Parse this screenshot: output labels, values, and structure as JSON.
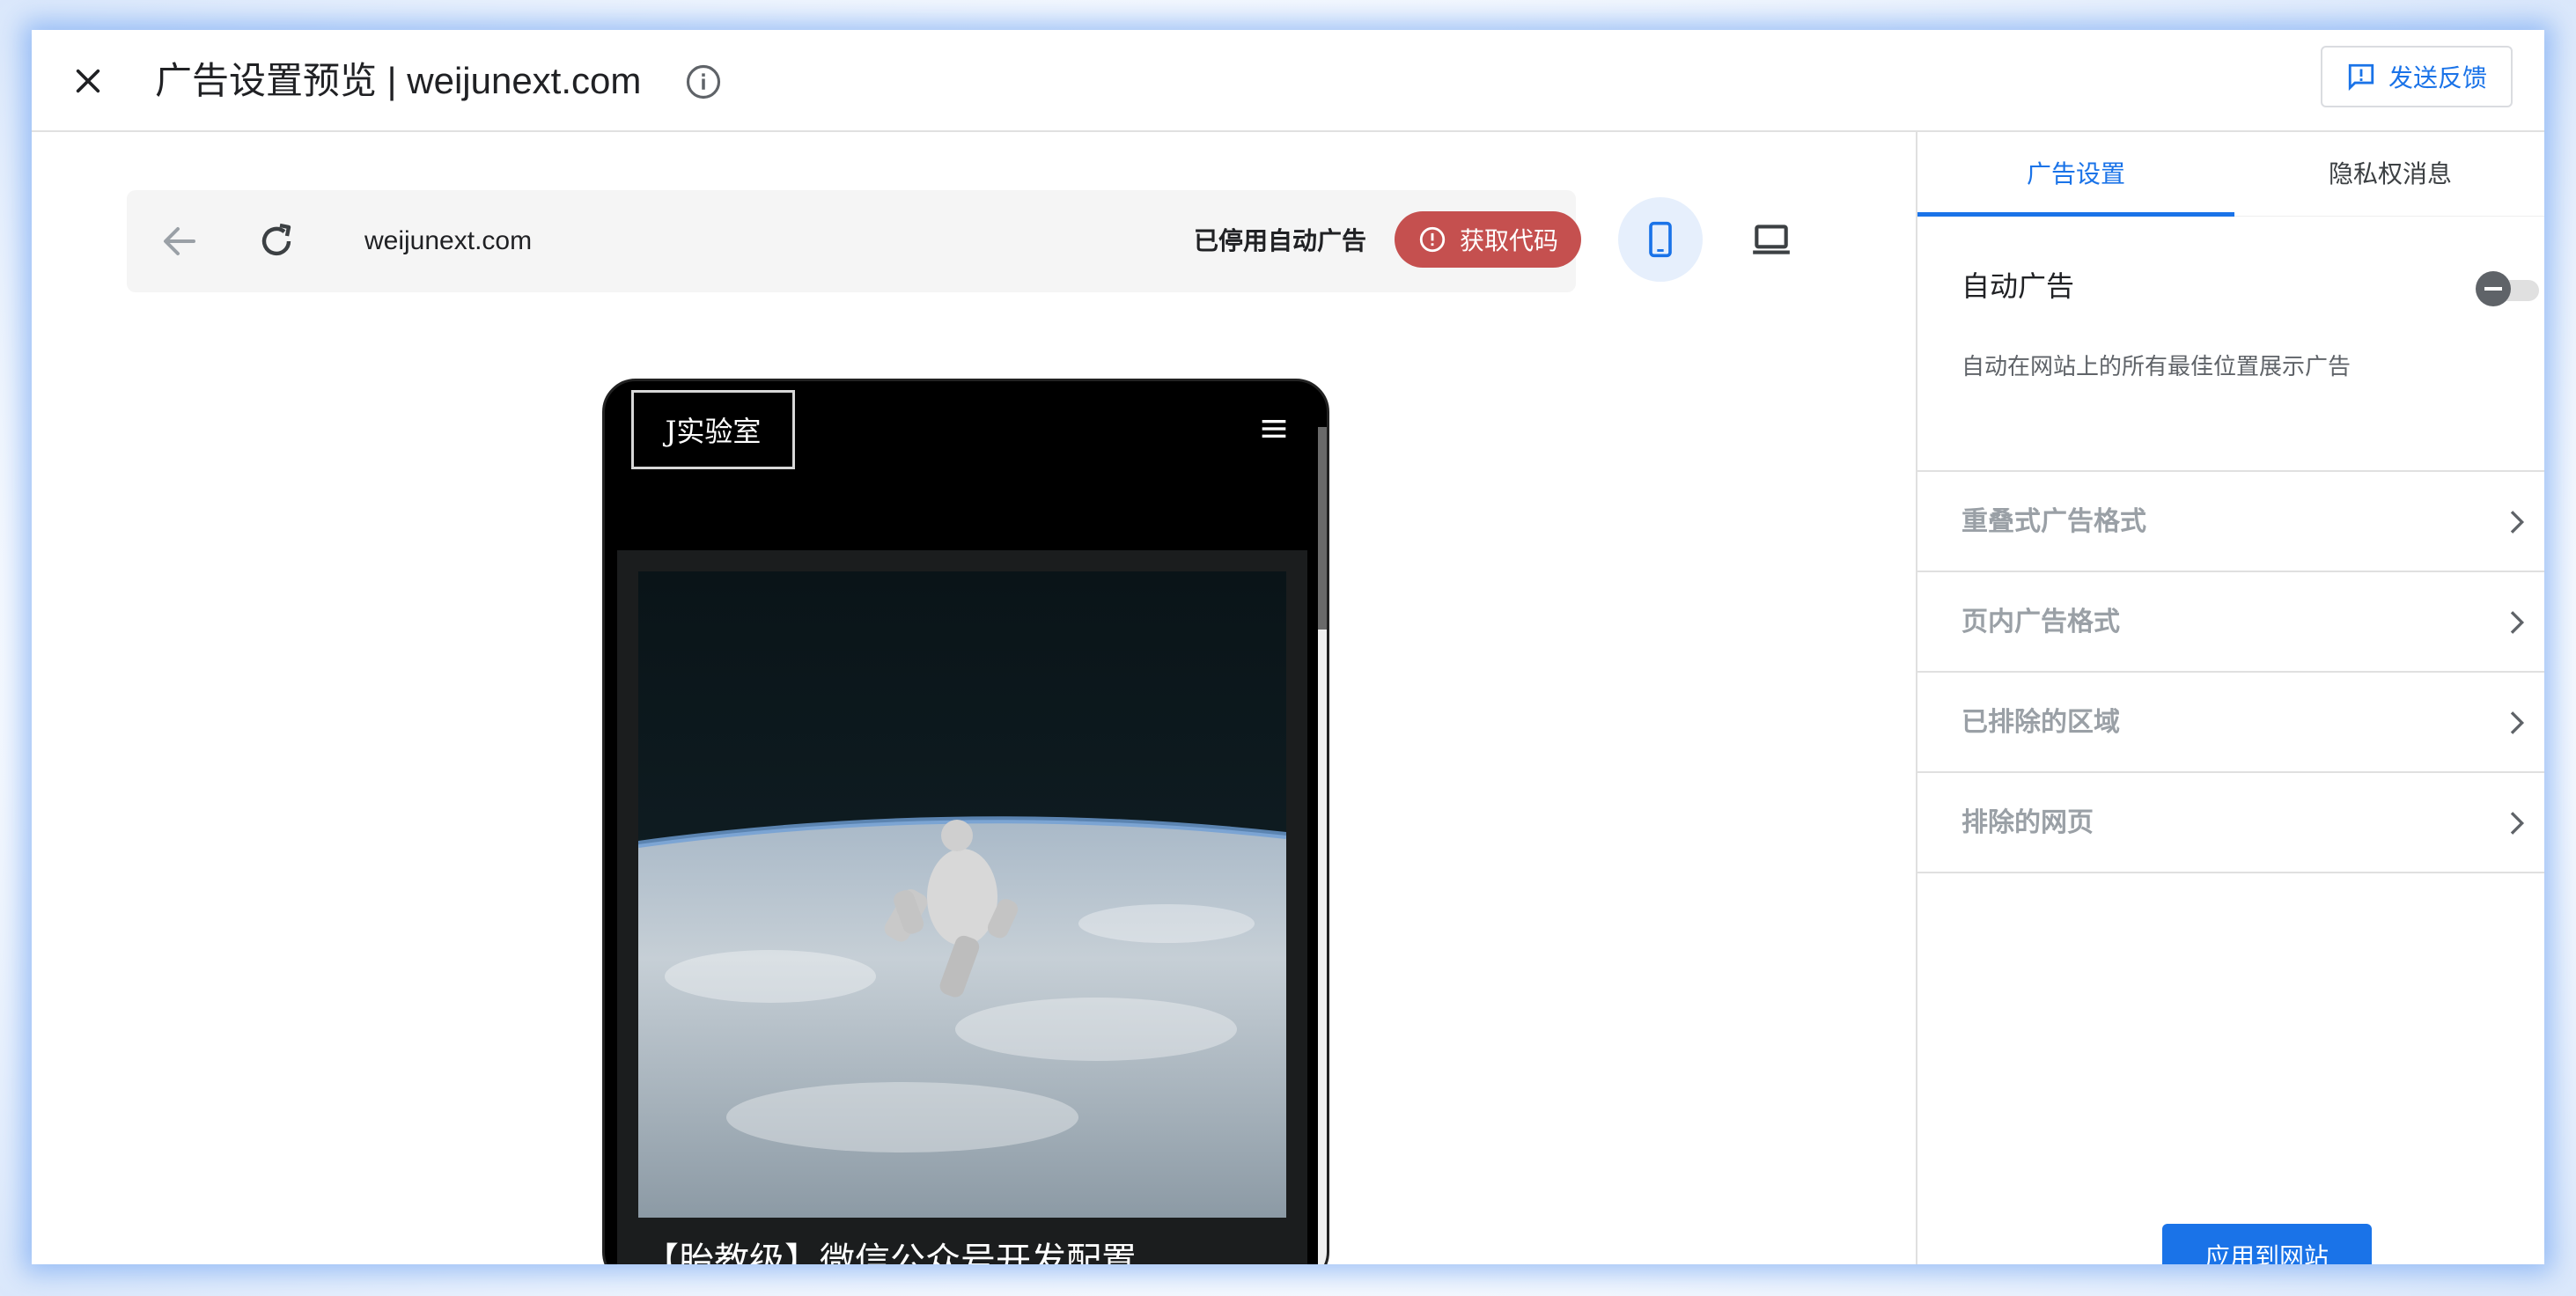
{
  "header": {
    "title": "广告设置预览 | weijunext.com",
    "feedback_label": "发送反馈"
  },
  "browser": {
    "url": "weijunext.com",
    "auto_ads_status": "已停用自动广告",
    "get_code_label": "获取代码"
  },
  "phone": {
    "site_logo": "J实验室",
    "post_title": "【胎教级】微信公众号开发配置"
  },
  "panel": {
    "tabs": [
      {
        "label": "广告设置",
        "active": true
      },
      {
        "label": "隐私权消息",
        "active": false
      }
    ],
    "auto_ads": {
      "label": "自动广告",
      "description": "自动在网站上的所有最佳位置展示广告",
      "enabled": false
    },
    "rows": [
      {
        "label": "重叠式广告格式"
      },
      {
        "label": "页内广告格式"
      },
      {
        "label": "已排除的区域"
      },
      {
        "label": "排除的网页"
      }
    ],
    "apply_label": "应用到网站"
  },
  "colors": {
    "accent": "#1a73e8",
    "get_code_bg": "#c5504f",
    "frame_glow": "#5a96f0"
  }
}
